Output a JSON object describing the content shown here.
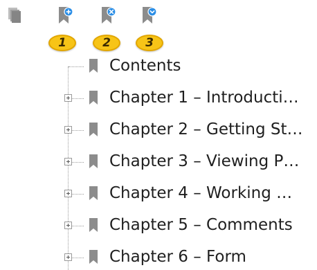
{
  "toolbar": {
    "buttons": [
      {
        "name": "add-bookmark",
        "icon": "bookmark-add-icon",
        "callout": "1"
      },
      {
        "name": "delete-bookmark",
        "icon": "bookmark-delete-icon",
        "callout": "2"
      },
      {
        "name": "collapse-bookmarks",
        "icon": "bookmark-collapse-icon",
        "callout": "3"
      }
    ]
  },
  "colors": {
    "accent_blue": "#2b8ee6",
    "bookmark_gray": "#8c8c8c",
    "callout_yellow": "#f7c417"
  },
  "bookmarks": [
    {
      "label": "Contents",
      "expandable": false
    },
    {
      "label": "Chapter 1 – Introducti…",
      "expandable": true
    },
    {
      "label": "Chapter 2 – Getting St…",
      "expandable": true
    },
    {
      "label": "Chapter 3 – Viewing P…",
      "expandable": true
    },
    {
      "label": "Chapter 4 – Working …",
      "expandable": true
    },
    {
      "label": "Chapter 5 – Comments",
      "expandable": true
    },
    {
      "label": "Chapter 6 – Form",
      "expandable": true
    }
  ]
}
